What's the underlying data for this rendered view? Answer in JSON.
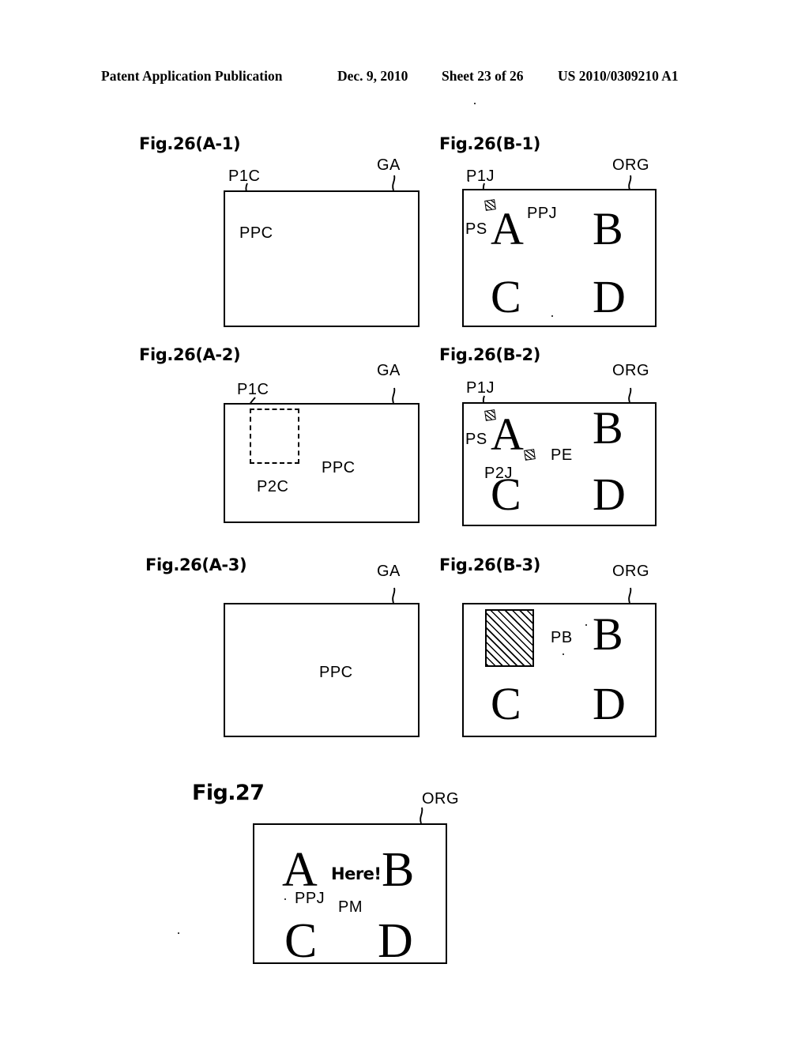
{
  "header": {
    "publication": "Patent Application Publication",
    "date": "Dec. 9, 2010",
    "sheet": "Sheet 23 of 26",
    "docnum": "US 2010/0309210 A1"
  },
  "figures": [
    {
      "id": "fig26-a1",
      "title": "Fig.26(A-1)",
      "screen_label": "GA",
      "content_letters": [],
      "annotations": [
        "P1C",
        "PPC"
      ],
      "description": "empty generated-image area with current pointer and ghost pointer"
    },
    {
      "id": "fig26-b1",
      "title": "Fig.26(B-1)",
      "screen_label": "ORG",
      "content_letters": [
        "A",
        "B",
        "C",
        "D"
      ],
      "annotations": [
        "P1J",
        "PS",
        "PPJ"
      ],
      "description": "original image with start point marker and pointer"
    },
    {
      "id": "fig26-a2",
      "title": "Fig.26(A-2)",
      "screen_label": "GA",
      "content_letters": [],
      "annotations": [
        "P1C",
        "P2C",
        "PPC"
      ],
      "description": "dashed drag-selection rectangle from P1C to P2C"
    },
    {
      "id": "fig26-b2",
      "title": "Fig.26(B-2)",
      "screen_label": "ORG",
      "content_letters": [
        "A",
        "B",
        "C",
        "D"
      ],
      "annotations": [
        "P1J",
        "PS",
        "P2J",
        "PE"
      ],
      "description": "original image with start marker PS and end marker PE"
    },
    {
      "id": "fig26-a3",
      "title": "Fig.26(A-3)",
      "screen_label": "GA",
      "content_letters": [],
      "annotations": [
        "PPC"
      ],
      "description": "empty area with pointer at centre"
    },
    {
      "id": "fig26-b3",
      "title": "Fig.26(B-3)",
      "screen_label": "ORG",
      "content_letters": [
        "B",
        "C",
        "D"
      ],
      "annotations": [
        "PB"
      ],
      "description": "original image where letter A is covered by hatched block PB"
    },
    {
      "id": "fig27",
      "title": "Fig.27",
      "screen_label": "ORG",
      "content_letters": [
        "A",
        "B",
        "C",
        "D"
      ],
      "annotations": [
        "PPJ",
        "PM"
      ],
      "message": "Here!",
      "description": "original image with pointer and message"
    }
  ],
  "labels": {
    "GA": "GA",
    "ORG": "ORG",
    "P1C": "P1C",
    "P2C": "P2C",
    "PPC": "PPC",
    "P1J": "P1J",
    "P2J": "P2J",
    "PPJ": "PPJ",
    "PS": "PS",
    "PE": "PE",
    "PB": "PB",
    "PM": "PM"
  },
  "letters": {
    "A": "A",
    "B": "B",
    "C": "C",
    "D": "D"
  },
  "message": {
    "here": "Here!"
  },
  "colors": {
    "ink": "#000000",
    "paper": "#ffffff"
  }
}
